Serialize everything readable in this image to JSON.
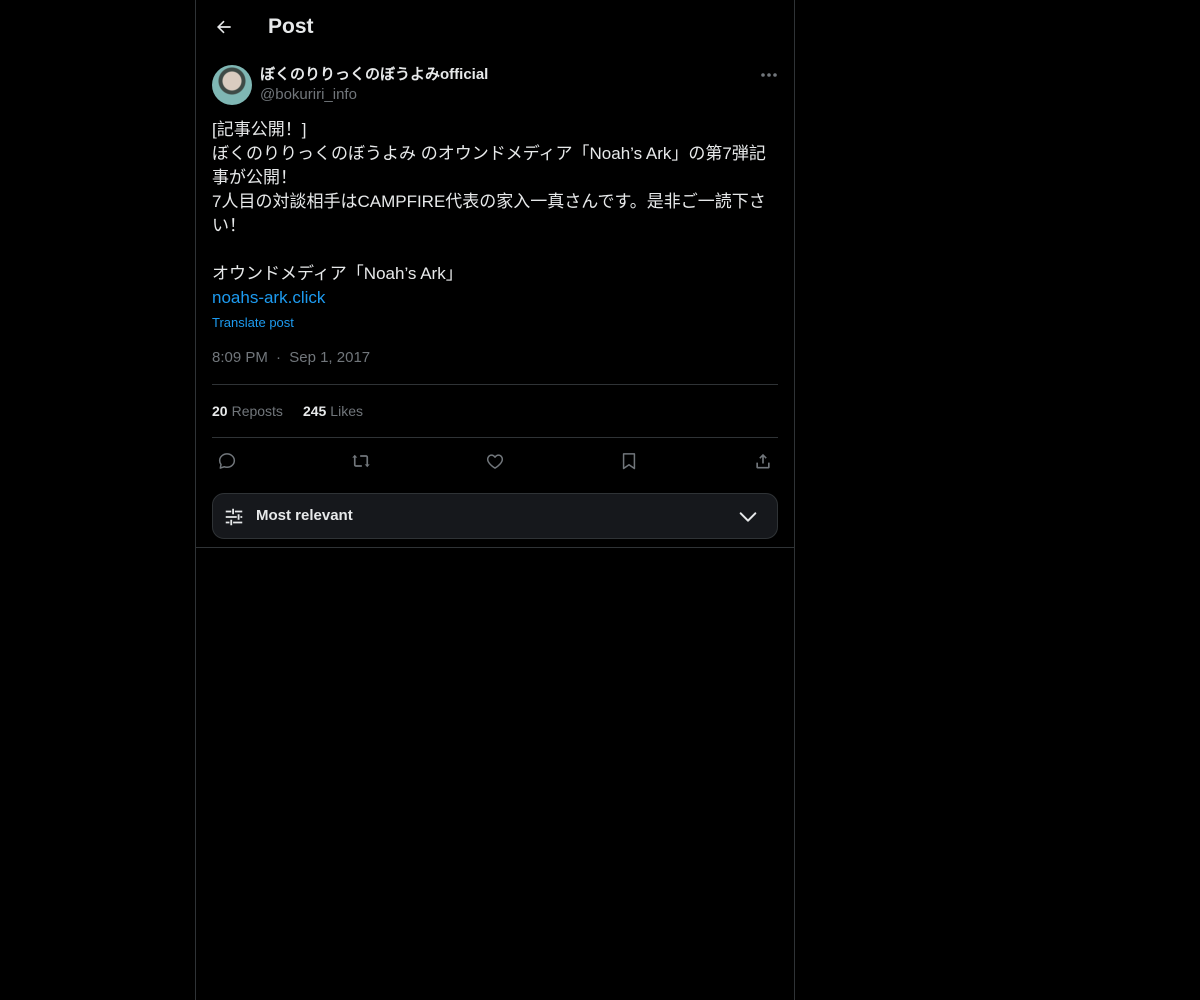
{
  "header": {
    "title": "Post"
  },
  "author": {
    "display_name": "ぼくのりりっくのぼうよみofficial",
    "handle": "@bokuriri_info"
  },
  "post": {
    "lines": [
      "[記事公開！]",
      "ぼくのりりっくのぼうよみ のオウンドメディア「Noah’s Ark」の第7弾記",
      "事が公開！",
      "7人目の対談相手はCAMPFIRE代表の家入一真さんです。是非ご一読下さ",
      "い！",
      "",
      "オウンドメディア「Noah’s Ark」"
    ],
    "link": "noahs-ark.click",
    "translate_label": "Translate post",
    "time": "8:09 PM",
    "separator": "·",
    "date": "Sep 1, 2017"
  },
  "stats": {
    "reposts_count": "20",
    "reposts_label": "Reposts",
    "likes_count": "245",
    "likes_label": "Likes"
  },
  "actions": [
    "reply-icon",
    "repost-icon",
    "like-icon",
    "bookmark-icon",
    "share-icon"
  ],
  "sort": {
    "label": "Most relevant"
  },
  "colors": {
    "background": "#000000",
    "text": "#e7e9ea",
    "muted": "#71767b",
    "accent": "#1d9bf0",
    "border": "#2f3336"
  }
}
